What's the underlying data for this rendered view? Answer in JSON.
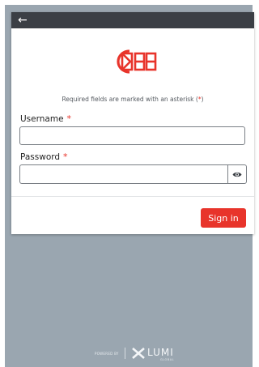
{
  "header": {
    "back_icon": "arrow-left-icon",
    "back_glyph": "←"
  },
  "logo": {
    "name": "brand-logo-icon",
    "color": "#e8342b"
  },
  "form": {
    "required_note_prefix": "Required fields are marked with an asterisk (",
    "required_note_asterisk": "*",
    "required_note_suffix": ")",
    "username_label": "Username",
    "password_label": "Password",
    "asterisk": "*",
    "username_value": "",
    "password_value": "",
    "password_toggle_icon": "eye-icon"
  },
  "actions": {
    "signin_label": "Sign in"
  },
  "footer": {
    "powered_by": "POWERED BY",
    "brand": "LUMI",
    "brand_sub": "GLOBAL"
  },
  "colors": {
    "accent": "#e8342b",
    "topbar": "#3b3f45",
    "backdrop": "#9aa6b0"
  }
}
